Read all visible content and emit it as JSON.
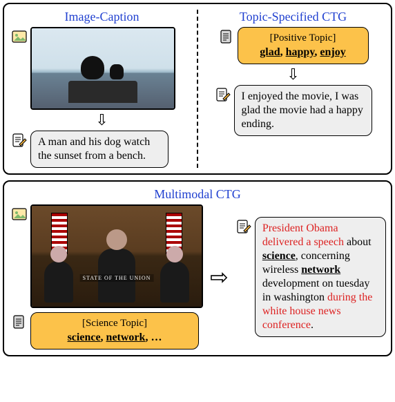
{
  "sections": {
    "image_caption": {
      "title": "Image-Caption"
    },
    "topic_ctg": {
      "title": "Topic-Specified CTG"
    },
    "multimodal": {
      "title": "Multimodal CTG"
    }
  },
  "image_caption": {
    "output": "A man and his dog watch the sunset from a bench."
  },
  "topic_ctg": {
    "topic_label": "[Positive Topic]",
    "topic_words": [
      {
        "text": "glad",
        "suffix": ", "
      },
      {
        "text": "happy",
        "suffix": ", "
      },
      {
        "text": "enjoy",
        "suffix": ""
      }
    ],
    "output": "I enjoyed the movie, I was glad the movie had a happy ending."
  },
  "multimodal": {
    "photo_strip": "STATE OF THE UNION",
    "topic_label": "[Science Topic]",
    "topic_words": [
      {
        "text": "science",
        "suffix": ", "
      },
      {
        "text": "network",
        "suffix": ", …"
      }
    ],
    "output_parts": {
      "p1": "President Obama delivered a speech",
      "p2": " about ",
      "w1": "science",
      "p3": ", concerning wireless ",
      "w2": "network",
      "p4": " development on tuesday in washington ",
      "p5": "during the white house news conference",
      "p6": "."
    }
  },
  "arrows": {
    "down": "⇩",
    "right": "⇨"
  }
}
